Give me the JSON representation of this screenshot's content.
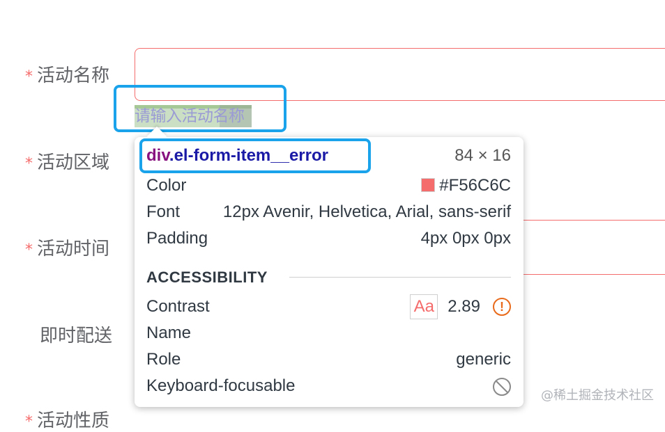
{
  "form": {
    "fields": [
      {
        "label": "活动名称",
        "required": true
      },
      {
        "label": "活动区域",
        "required": true
      },
      {
        "label": "活动时间",
        "required": true
      },
      {
        "label": "即时配送",
        "required": false
      },
      {
        "label": "活动性质",
        "required": true
      }
    ],
    "asterisk": "*",
    "error_message": "请输入活动名称"
  },
  "inspector": {
    "selector_tag": "div",
    "selector_class": ".el-form-item__error",
    "dimensions": "84 × 16",
    "rows": [
      {
        "label": "Color",
        "value": "#F56C6C"
      },
      {
        "label": "Font",
        "value": "12px Avenir, Helvetica, Arial, sans-serif"
      },
      {
        "label": "Padding",
        "value": "4px 0px 0px"
      }
    ],
    "accessibility": {
      "title": "ACCESSIBILITY",
      "contrast_label": "Contrast",
      "contrast_sample": "Aa",
      "contrast_value": "2.89",
      "name_label": "Name",
      "name_value": "",
      "role_label": "Role",
      "role_value": "generic",
      "keyboard_label": "Keyboard-focusable"
    }
  },
  "colors": {
    "error": "#f56c6c",
    "highlight_border": "#1aa3ea",
    "warning": "#e86a1a"
  },
  "watermark": "@稀土掘金技术社区"
}
